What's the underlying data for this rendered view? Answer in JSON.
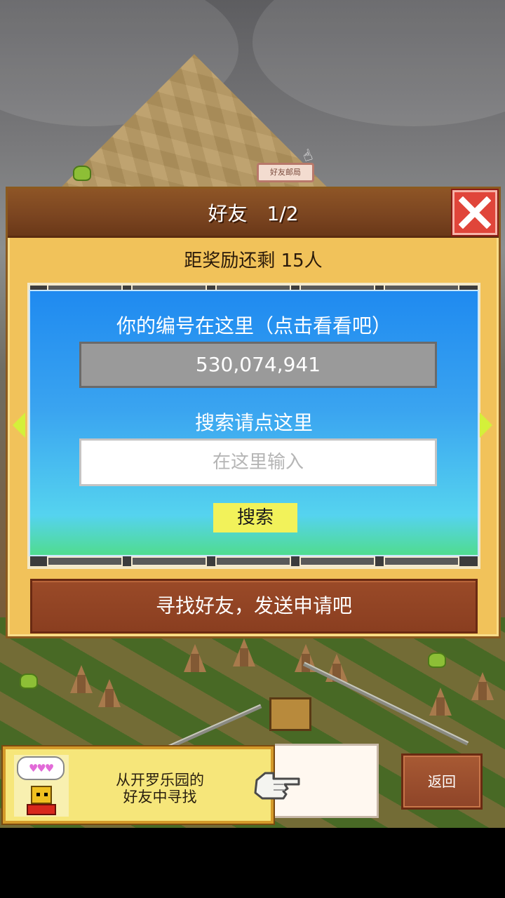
{
  "map": {
    "post_sign": "好友邮局"
  },
  "dialog": {
    "title": "好友　1/2",
    "reward_text": "距奖励还剩 15人",
    "id_caption": "你的编号在这里（点击看看吧）",
    "player_id": "530,074,941",
    "search_caption": "搜索请点这里",
    "search_placeholder": "在这里输入",
    "search_value": "",
    "search_button": "搜索",
    "find_button": "寻找好友，发送申请吧"
  },
  "bottom": {
    "bubble": "♥♥♥",
    "prompt_line1": "从开罗乐园的",
    "prompt_line2": "好友中寻找",
    "back_button": "返回"
  },
  "colors": {
    "dialog_bg": "#f1c25a",
    "header_brown": "#7a4420",
    "panel_blue": "#1f8af0",
    "search_yellow": "#f2f25a",
    "close_red": "#e0453a"
  }
}
